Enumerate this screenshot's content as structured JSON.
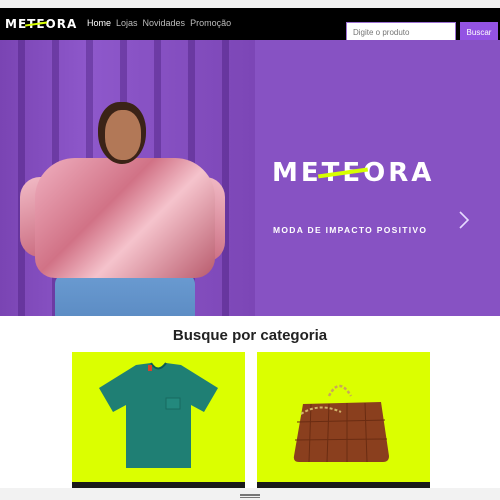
{
  "navbar": {
    "logo_parts": [
      "ME",
      "TE",
      "ORA"
    ],
    "links": [
      {
        "label": "Home",
        "active": true
      },
      {
        "label": "Lojas",
        "active": false
      },
      {
        "label": "Novidades",
        "active": false
      },
      {
        "label": "Promoção",
        "active": false
      }
    ],
    "search_placeholder": "Digite o produto",
    "search_button": "Buscar"
  },
  "hero": {
    "title_parts": [
      "ME",
      "TE",
      "ORA"
    ],
    "subtitle": "MODA DE IMPACTO POSITIVO",
    "next_icon": "chevron-right-icon",
    "slides": 3,
    "active_slide": 1
  },
  "categories": {
    "title": "Busque por categoria",
    "card_color": "#dbff00"
  },
  "colors": {
    "accent": "#9353e3",
    "hero_bg": "#8752c3",
    "brand_highlight": "#d7ff00"
  }
}
